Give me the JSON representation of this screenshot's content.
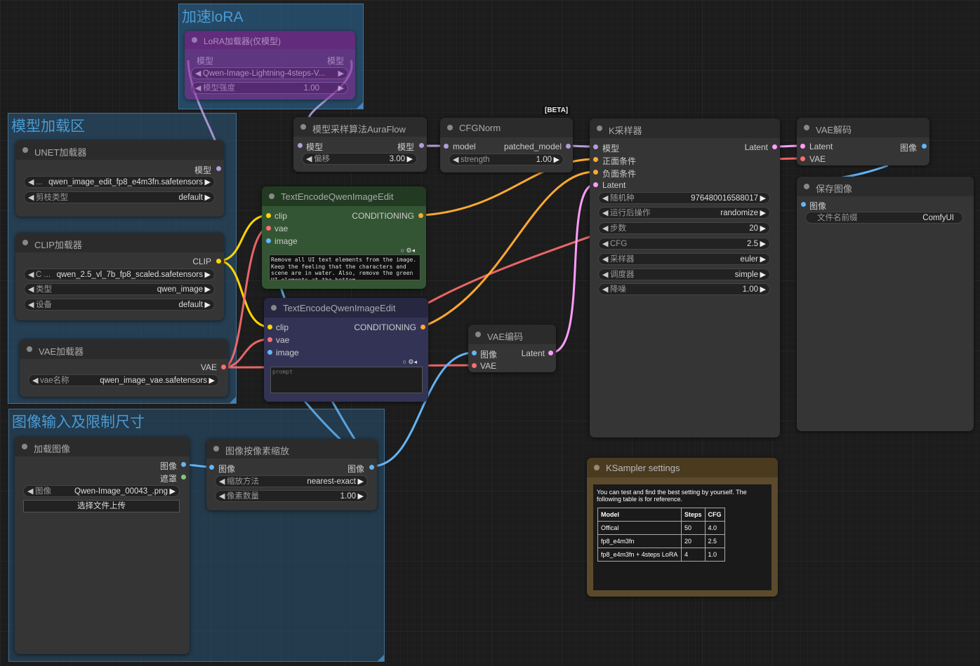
{
  "groups": {
    "lora": "加速loRA",
    "model": "模型加载区",
    "image": "图像输入及限制尺寸"
  },
  "lora_node": {
    "title": "LoRA加载器(仅模型)",
    "in": "模型",
    "out": "模型",
    "lora_name": "Qwen-Image-Lightning-4steps-V...",
    "strength_label": "模型强度",
    "strength": "1.00"
  },
  "unet": {
    "title": "UNET加载器",
    "out": "模型",
    "unet_name": "qwen_image_edit_fp8_e4m3fn.safetensors",
    "unet_prefix": "...",
    "dtype_label": "剪枝类型",
    "dtype": "default"
  },
  "clip": {
    "title": "CLIP加载器",
    "out": "CLIP",
    "clip_prefix": "C ...",
    "clip_name": "qwen_2.5_vl_7b_fp8_scaled.safetensors",
    "type_label": "类型",
    "type": "qwen_image",
    "device_label": "设备",
    "device": "default"
  },
  "vae_loader": {
    "title": "VAE加载器",
    "out": "VAE",
    "name_label": "vae名称",
    "name": "qwen_image_vae.safetensors"
  },
  "auraflow": {
    "title": "模型采样算法AuraFlow",
    "in": "模型",
    "out": "模型",
    "shift_label": "偏移",
    "shift": "3.00"
  },
  "cfgnorm": {
    "title": "CFGNorm",
    "badge": "[BETA]",
    "in": "model",
    "out": "patched_model",
    "strength_label": "strength",
    "strength": "1.00"
  },
  "te1": {
    "title": "TextEncodeQwenImageEdit",
    "in": [
      "clip",
      "vae",
      "image"
    ],
    "out": "CONDITIONING",
    "prompt": "Remove all UI text elements from the image. Keep the feeling that the characters and scene are in water. Also, remove the green UI elements at the bottom"
  },
  "te2": {
    "title": "TextEncodeQwenImageEdit",
    "in": [
      "clip",
      "vae",
      "image"
    ],
    "out": "CONDITIONING",
    "placeholder": "prompt"
  },
  "vae_encode": {
    "title": "VAE编码",
    "in": [
      "图像",
      "VAE"
    ],
    "out": "Latent"
  },
  "ksampler": {
    "title": "K采样器",
    "in": [
      "模型",
      "正面条件",
      "负面条件",
      "Latent"
    ],
    "out": "Latent",
    "widgets": [
      {
        "label": "随机种",
        "value": "976480016588017"
      },
      {
        "label": "运行后操作",
        "value": "randomize"
      },
      {
        "label": "步数",
        "value": "20"
      },
      {
        "label": "CFG",
        "value": "2.5"
      },
      {
        "label": "采样器",
        "value": "euler"
      },
      {
        "label": "调度器",
        "value": "simple"
      },
      {
        "label": "降噪",
        "value": "1.00"
      }
    ]
  },
  "vae_decode": {
    "title": "VAE解码",
    "in": [
      "Latent",
      "VAE"
    ],
    "out": "图像"
  },
  "save": {
    "title": "保存图像",
    "in": "图像",
    "prefix_label": "文件名前缀",
    "prefix": "ComfyUI"
  },
  "load_image": {
    "title": "加载图像",
    "out": [
      "图像",
      "遮罩"
    ],
    "image_label": "图像",
    "image": "Qwen-Image_00043_.png",
    "upload": "选择文件上传"
  },
  "scale": {
    "title": "图像按像素缩放",
    "in": "图像",
    "out": "图像",
    "method_label": "缩放方法",
    "method": "nearest-exact",
    "mp_label": "像素数量",
    "mp": "1.00"
  },
  "note": {
    "title": "KSampler settings",
    "text": "You can test and find the best setting by yourself. The following table is for reference.",
    "headers": [
      "Model",
      "Steps",
      "CFG"
    ],
    "rows": [
      [
        "Offical",
        "50",
        "4.0"
      ],
      [
        "fp8_e4m3fn",
        "20",
        "2.5"
      ],
      [
        "fp8_e4m3fn + 4steps LoRA",
        "4",
        "1.0"
      ]
    ]
  },
  "colors": {
    "model": "#b39ddb",
    "clip": "#ffd500",
    "vae": "#ff6e6e",
    "image": "#64b5f6",
    "latent": "#ff9cf9",
    "conditioning": "#ffa931"
  },
  "icons": {
    "node_dot": "circle",
    "arrow_left": "triangle-left",
    "arrow_right": "triangle-right",
    "gear": "gear-icon",
    "speaker": "speaker-icon"
  }
}
